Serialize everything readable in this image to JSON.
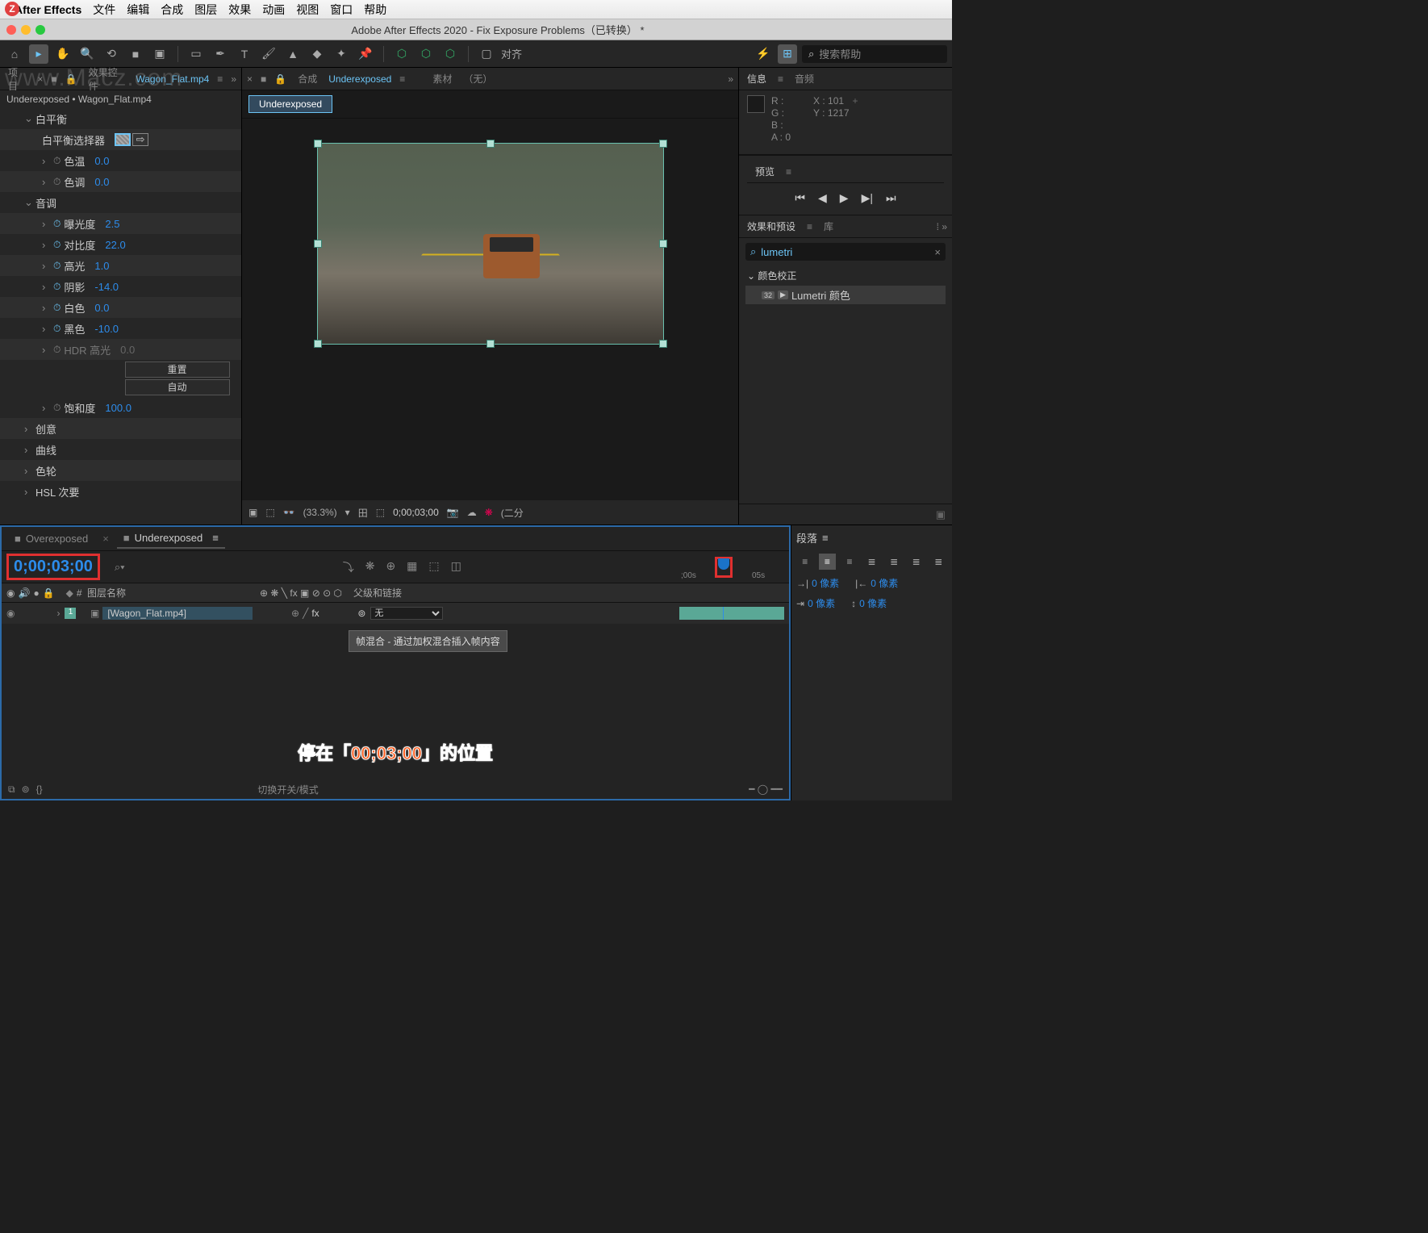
{
  "mac_menu": {
    "apple": "",
    "app": "After Effects",
    "items": [
      "文件",
      "编辑",
      "合成",
      "图层",
      "效果",
      "动画",
      "视图",
      "窗口",
      "帮助"
    ]
  },
  "titlebar": "Adobe After Effects 2020 - Fix Exposure Problems（已转换） *",
  "toolbar": {
    "align": "对齐",
    "search_placeholder": "搜索帮助"
  },
  "project_panel": {
    "tab_project": "项目",
    "tab_effect_controls": "效果控件",
    "tab_effect_target": "Wagon_Flat.mp4",
    "breadcrumb": "Underexposed • Wagon_Flat.mp4",
    "groups": {
      "white_balance": "白平衡",
      "white_balance_selector": "白平衡选择器",
      "color_temp": "色温",
      "color_temp_val": "0.0",
      "tint": "色调",
      "tint_val": "0.0",
      "tone": "音调",
      "exposure": "曝光度",
      "exposure_val": "2.5",
      "contrast": "对比度",
      "contrast_val": "22.0",
      "highlights": "高光",
      "highlights_val": "1.0",
      "shadows": "阴影",
      "shadows_val": "-14.0",
      "whites": "白色",
      "whites_val": "0.0",
      "blacks": "黑色",
      "blacks_val": "-10.0",
      "hdr": "HDR 高光",
      "hdr_val": "0.0",
      "reset_btn": "重置",
      "auto_btn": "自动",
      "saturation": "饱和度",
      "saturation_val": "100.0",
      "creative": "创意",
      "curves": "曲线",
      "color_wheels": "色轮",
      "hsl": "HSL 次要"
    }
  },
  "comp_panel": {
    "tab_comp": "合成",
    "tab_comp_name": "Underexposed",
    "tab_footage": "素材",
    "tab_none": "（无）",
    "active_tab": "Underexposed",
    "zoom": "(33.3%)",
    "timecode": "0;00;03;00",
    "res": "(二分"
  },
  "info_panel": {
    "title": "信息",
    "audio": "音频",
    "r": "R :",
    "g": "G :",
    "b": "B :",
    "a": "A :  0",
    "x": "X : 101",
    "y": "Y : 1217"
  },
  "preview_panel": {
    "title": "预览"
  },
  "effects_presets": {
    "title": "效果和预设",
    "library": "库",
    "search": "lumetri",
    "group": "颜色校正",
    "item": "Lumetri 颜色",
    "badge1": "32",
    "badge2": "▶"
  },
  "timeline": {
    "tab1": "Overexposed",
    "tab2": "Underexposed",
    "timecode": "0;00;03;00",
    "ruler_labels": [
      ";00s",
      "05s"
    ],
    "col_num": "#",
    "col_name": "图层名称",
    "col_parent": "父级和链接",
    "layer1": {
      "num": "1",
      "name": "[Wagon_Flat.mp4]",
      "parent": "无"
    },
    "tooltip": "帧混合 - 通过加权混合插入帧内容",
    "footer_switch": "切换开关/模式"
  },
  "paragraph": {
    "title": "段落",
    "indent_label": "0 像素"
  },
  "annotation": "停在「00;03;00」的位置",
  "watermark": "www.Macz.com"
}
